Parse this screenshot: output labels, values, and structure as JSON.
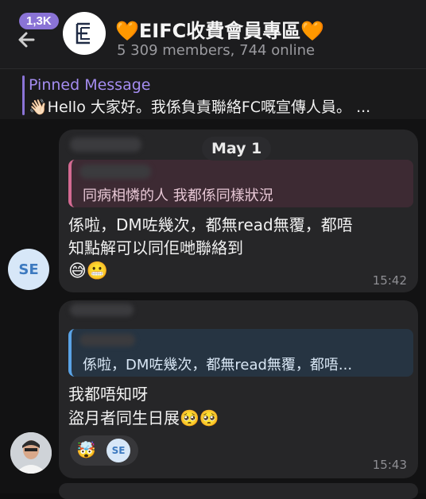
{
  "header": {
    "unread_badge": "1,3K",
    "title": "🧡EIFC收費會員專區🧡",
    "subtitle": "5 309 members, 744 online"
  },
  "pinned": {
    "label": "Pinned Message",
    "text": "👋🏻Hello 大家好。我係負責聯絡FC嘅宣傳人員。 ..."
  },
  "chat": {
    "date_chip": "May 1",
    "messages": [
      {
        "reply_text": "同病相憐的人 我都係同樣狀況",
        "text_line1": "係啦，DM咗幾次，都無read無覆，都唔",
        "text_line2": "知點解可以同佢哋聯絡到",
        "emojis": "😅😬",
        "time": "15:42",
        "avatar_initials": "SE"
      },
      {
        "reply_text": "係啦，DM咗幾次，都無read無覆，都唔...",
        "text_line1": "我都唔知呀",
        "text_line2": "盜月者同生日展🥺🥺",
        "reaction_emoji": "🤯",
        "reaction_user_initials": "SE",
        "time": "15:43"
      }
    ]
  },
  "colors": {
    "accent": "#8a73d6",
    "reply_pink": "#d46a92",
    "reply_blue": "#5aa3e6"
  }
}
